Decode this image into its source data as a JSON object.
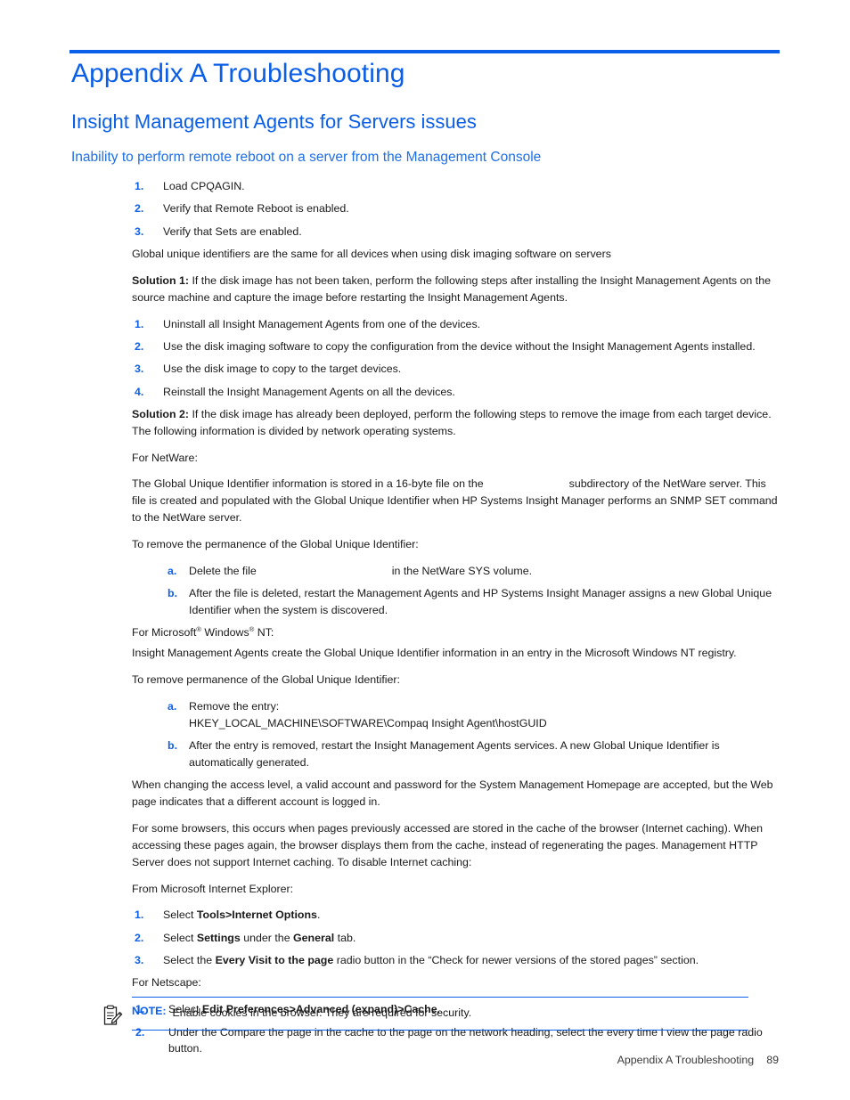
{
  "document": {
    "heading1": "Appendix A Troubleshooting",
    "heading2": "Insight Management Agents for Servers issues",
    "heading3": "Inability to perform remote reboot on a server from the Management Console",
    "accent_color": "#0b5ee8",
    "body_color": "#1a1a1a"
  },
  "sections": {
    "reboot_steps": {
      "items": [
        {
          "marker": "1.",
          "text": "Load CPQAGIN."
        },
        {
          "marker": "2.",
          "text": "Verify that Remote Reboot is enabled."
        },
        {
          "marker": "3.",
          "text": "Verify that Sets are enabled."
        }
      ]
    },
    "guid_issue_title": "Global unique identifiers are the same for all devices when using disk imaging software on servers",
    "solution1": {
      "label": "Solution 1:",
      "text": " If the disk image has not been taken, perform the following steps after installing the Insight Management Agents on the source machine and capture the image before restarting the Insight Management Agents.",
      "items": [
        {
          "marker": "1.",
          "text": "Uninstall all Insight Management Agents from one of the devices."
        },
        {
          "marker": "2.",
          "text": "Use the disk imaging software to copy the configuration from the device without the Insight Management Agents installed."
        },
        {
          "marker": "3.",
          "text": "Use the disk image to copy to the target devices."
        },
        {
          "marker": "4.",
          "text": "Reinstall the Insight Management Agents on all the devices."
        }
      ]
    },
    "solution2": {
      "label": "Solution 2:",
      "text": " If the disk image has already been deployed, perform the following steps to remove the image from each target device. The following information is divided by network operating systems."
    },
    "netware": {
      "lead": "For NetWare:",
      "para_part1": "The Global Unique Identifier information is stored in a 16-byte file on the",
      "para_part2": "subdirectory of the NetWare server. This file is created and populated with the Global Unique Identifier when HP Systems Insight Manager performs an SNMP SET command to the NetWare server.",
      "remove_lead": "To remove the permanence of the Global Unique Identifier:",
      "items": [
        {
          "marker": "a.",
          "text_part1": "Delete the file",
          "text_part2": "in the NetWare SYS volume."
        },
        {
          "marker": "b.",
          "text": "After the file is deleted, restart the Management Agents and HP Systems Insight Manager assigns a new Global Unique Identifier when the system is discovered."
        }
      ]
    },
    "windows_nt": {
      "lead_part1": "For Microsoft",
      "lead_part2": " Windows",
      "lead_part3": " NT:",
      "registered_mark": "®",
      "para": "Insight Management Agents create the Global Unique Identifier information in an entry in the Microsoft Windows NT registry.",
      "remove_lead": "To remove permanence of the Global Unique Identifier:",
      "items": [
        {
          "marker": "a.",
          "text": "Remove the entry:",
          "registry_key": "HKEY_LOCAL_MACHINE\\SOFTWARE\\Compaq Insight Agent\\hostGUID"
        },
        {
          "marker": "b.",
          "text": "After the entry is removed, restart the Insight Management Agents services. A new Global Unique Identifier is automatically generated."
        }
      ]
    },
    "caching": {
      "para1": "When changing the access level, a valid account and password for the System Management Homepage are accepted, but the Web page indicates that a different account is logged in.",
      "para2": "For some browsers, this occurs when pages previously accessed are stored in the cache of the browser (Internet caching). When accessing these pages again, the browser displays them from the cache, instead of regenerating the pages. Management HTTP Server does not support Internet caching. To disable Internet caching:",
      "ie_lead": "From Microsoft Internet Explorer:",
      "ie_items": [
        {
          "marker": "1.",
          "pre": "Select ",
          "bold": "Tools>Internet Options",
          "post": "."
        },
        {
          "marker": "2.",
          "pre": "Select ",
          "bold": "Settings",
          "mid": " under the ",
          "bold2": "General",
          "post": " tab."
        },
        {
          "marker": "3.",
          "pre": "Select the ",
          "bold": "Every Visit to the page",
          "post": " radio button in the “Check for newer versions of the stored pages” section."
        }
      ],
      "netscape_lead": "For Netscape:",
      "netscape_items": [
        {
          "marker": "1.",
          "pre": "Select ",
          "bold": "Edit Preferences>Advanced (expand)>Cache",
          "post": "."
        },
        {
          "marker": "2.",
          "text": "Under the Compare the page in the cache to the page on the network heading, select the every time I view the page radio button."
        }
      ]
    }
  },
  "note": {
    "icon": "note-clipboard-icon",
    "label": "NOTE:",
    "text": "Enable cookies in the browser. They are required for security."
  },
  "footer": {
    "title": "Appendix A Troubleshooting",
    "page_number": "89"
  }
}
